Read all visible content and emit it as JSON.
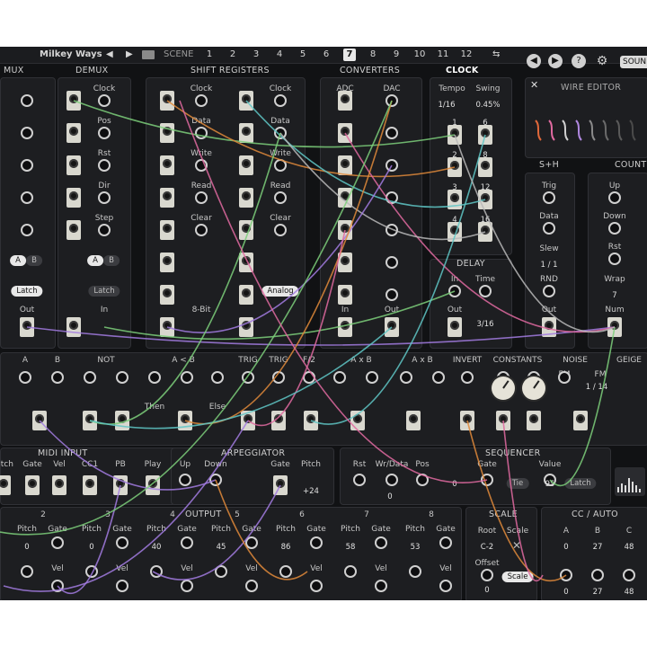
{
  "topbar": {
    "project_name": "Milkey Ways",
    "scene_label": "SCENE",
    "scenes": [
      "1",
      "2",
      "3",
      "4",
      "5",
      "6",
      "7",
      "8",
      "9",
      "10",
      "11",
      "12"
    ],
    "active_scene": "7",
    "sound_label": "SOUN"
  },
  "modules": {
    "mux": {
      "title": "MUX",
      "latch": "Latch",
      "out": "Out",
      "ab": [
        "A",
        "B"
      ]
    },
    "demux": {
      "title": "DEMUX",
      "labels": [
        "Clock",
        "Pos",
        "Rst",
        "Dir",
        "Step"
      ],
      "latch": "Latch",
      "in": "In",
      "ab": [
        "A",
        "B"
      ]
    },
    "shift_registers": {
      "title": "SHIFT REGISTERS",
      "col1": [
        "Clock",
        "Data",
        "Write",
        "Read",
        "Clear"
      ],
      "col2": [
        "Clock",
        "Data",
        "Write",
        "Read",
        "Clear"
      ],
      "bit": "8-Bit",
      "analog": "Analog"
    },
    "converters": {
      "title": "CONVERTERS",
      "adc": "ADC",
      "dac": "DAC",
      "in": "In",
      "out": "Out"
    },
    "clock": {
      "title": "CLOCK",
      "tempo_label": "Tempo",
      "tempo_value": "1/16",
      "swing_label": "Swing",
      "swing_value": "0.45%",
      "divs_left": [
        "1",
        "2",
        "3",
        "4"
      ],
      "divs_right": [
        "6",
        "8",
        "12",
        "16"
      ]
    },
    "delay": {
      "title": "DELAY",
      "in": "In",
      "time": "Time",
      "out": "Out",
      "time_value": "3/16"
    },
    "wire_editor": {
      "title": "WIRE EDITOR"
    },
    "sh": {
      "title": "S+H",
      "trig": "Trig",
      "data": "Data",
      "slew": "Slew",
      "slew_value": "1 / 1",
      "rnd": "RND",
      "out": "Out"
    },
    "counter": {
      "title": "COUNTE",
      "up": "Up",
      "down": "Down",
      "rst": "Rst",
      "wrap": "Wrap",
      "wrap_value": "7",
      "num": "Num"
    },
    "logic_row": {
      "labels": [
        "A",
        "B",
        "NOT",
        "A < B",
        "TRIG",
        "TRIG",
        "F/2",
        "A x B",
        "A x B",
        "INVERT",
        "CONSTANTS",
        "NOISE",
        "GEIGE",
        "FM",
        "FM"
      ],
      "then": "Then",
      "else": "Else",
      "fm_value": "1 / 14"
    },
    "midi_input": {
      "title": "MIDI INPUT",
      "labels": [
        "Pitch",
        "Gate",
        "Vel",
        "CC1",
        "PB",
        "Play"
      ]
    },
    "arpeggiator": {
      "title": "ARPEGGIATOR",
      "labels": [
        "Up",
        "Down",
        "Gate",
        "Pitch"
      ],
      "pitch_value": "+24"
    },
    "sequencer": {
      "title": "SEQUENCER",
      "labels": [
        "Rst",
        "Wr/Data",
        "Pos",
        "Gate",
        "Value"
      ],
      "rst_value": "0",
      "pos_value": "0",
      "gate_value": "Tie",
      "value_value": "95",
      "latch": "Latch"
    },
    "output": {
      "title": "OUTPUT",
      "numbers": [
        "2",
        "3",
        "4",
        "5",
        "6",
        "7",
        "8"
      ],
      "pitch": "Pitch",
      "gate": "Gate",
      "vel": "Vel",
      "pitch_values": [
        "0",
        "0",
        "40",
        "45",
        "86",
        "58",
        "53"
      ]
    },
    "scale": {
      "title": "SCALE",
      "root": "Root",
      "root_value": "C-2",
      "scale": "Scale",
      "offset": "Offset",
      "offset_value": "0",
      "scale_pill": "Scale"
    },
    "cc_auto": {
      "title": "CC / AUTO",
      "labels": [
        "A",
        "B",
        "C"
      ],
      "values": [
        "0",
        "27",
        "48"
      ],
      "bottom_values": [
        "0",
        "27",
        "48"
      ]
    }
  },
  "colors": {
    "background": "#111214",
    "panel": "#1d1e21",
    "jack": "#d9d8cf",
    "accent_wire_purple": "#a27be0",
    "accent_wire_green": "#7ccf7a",
    "accent_wire_orange": "#e08a3a",
    "accent_wire_teal": "#5fc7c5",
    "accent_wire_pink": "#e06aa0"
  },
  "icons": [
    "prev-arrow-icon",
    "next-arrow-icon",
    "help-icon",
    "gear-icon",
    "keyboard-icon",
    "close-icon",
    "wire-preset-icon"
  ]
}
